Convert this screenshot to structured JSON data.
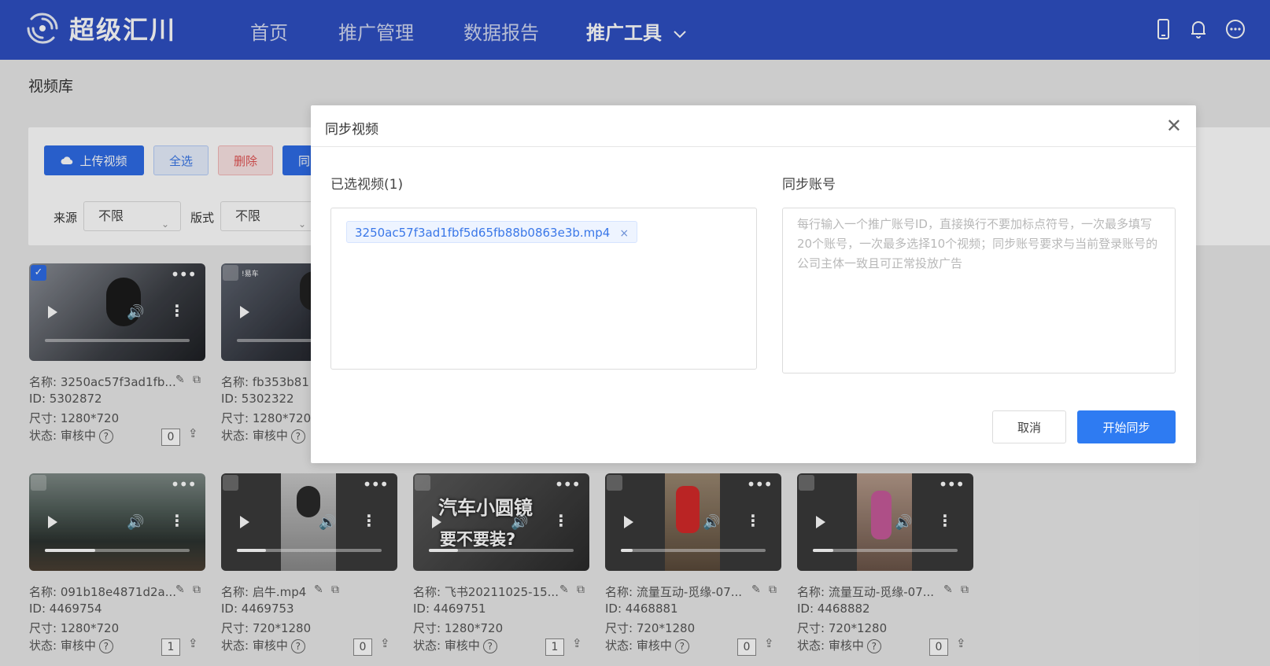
{
  "app": {
    "logo_text": "超级汇川"
  },
  "nav": {
    "items": [
      {
        "label": "首页"
      },
      {
        "label": "推广管理"
      },
      {
        "label": "数据报告"
      },
      {
        "label": "推广工具"
      }
    ],
    "icons": [
      "mobile-icon",
      "bell-icon",
      "more-circle-icon"
    ]
  },
  "page": {
    "title": "视频库"
  },
  "toolbar": {
    "upload_label": "上传视频",
    "select_all_label": "全选",
    "delete_label": "删除",
    "sync_label_partial": "同",
    "source_label": "来源",
    "source_value": "不限",
    "format_label": "版式",
    "format_value": "不限"
  },
  "videos": [
    {
      "name": "名称:  3250ac57f3ad1fb...",
      "id": "ID:  5302872",
      "size": "尺寸:  1280*720",
      "status": "状态:  审核中",
      "count": "0",
      "checked": true,
      "progress": 0
    },
    {
      "name": "名称:  fb353b81",
      "id": "ID:  5302322",
      "size": "尺寸:  1280*720",
      "status": "状态:  审核中",
      "count": "",
      "checked": false,
      "progress": 0
    },
    {
      "name": "名称:  091b18e4871d2a...",
      "id": "ID:  4469754",
      "size": "尺寸:  1280*720",
      "status": "状态:  审核中",
      "count": "1",
      "checked": false,
      "progress": 0.35
    },
    {
      "name": "名称:  启牛.mp4",
      "id": "ID:  4469753",
      "size": "尺寸:  720*1280",
      "status": "状态:  审核中",
      "count": "0",
      "checked": false,
      "progress": 0.2
    },
    {
      "name": "名称:  飞书20211025-15...",
      "id": "ID:  4469751",
      "size": "尺寸:  1280*720",
      "status": "状态:  审核中",
      "count": "1",
      "checked": false,
      "progress": 0.2
    },
    {
      "name": "名称:  流量互动-觅缘-07...",
      "id": "ID:  4468881",
      "size": "尺寸:  720*1280",
      "status": "状态:  审核中",
      "count": "0",
      "checked": false,
      "progress": 0.08
    },
    {
      "name": "名称:  流量互动-觅缘-07...",
      "id": "ID:  4468882",
      "size": "尺寸:  720*1280",
      "status": "状态:  审核中",
      "count": "0",
      "checked": false,
      "progress": 0.14
    }
  ],
  "thumb_text": {
    "brand": "!易车",
    "caption_line1": "汽车小圆镜",
    "caption_line2": "要不要装?"
  },
  "modal": {
    "title": "同步视频",
    "selected_label": "已选视频(1)",
    "selected_tag": "3250ac57f3ad1fbf5d65fb88b0863e3b.mp4",
    "account_label": "同步账号",
    "account_placeholder": "每行输入一个推广账号ID，直接换行不要加标点符号，一次最多填写20个账号，一次最多选择10个视频；同步账号要求与当前登录账号的公司主体一致且可正常投放广告",
    "cancel_label": "取消",
    "start_label": "开始同步"
  },
  "colors": {
    "nav_bg": "#2e4fc2",
    "primary": "#2e7bf2",
    "danger_bg": "#fbe4e4"
  }
}
